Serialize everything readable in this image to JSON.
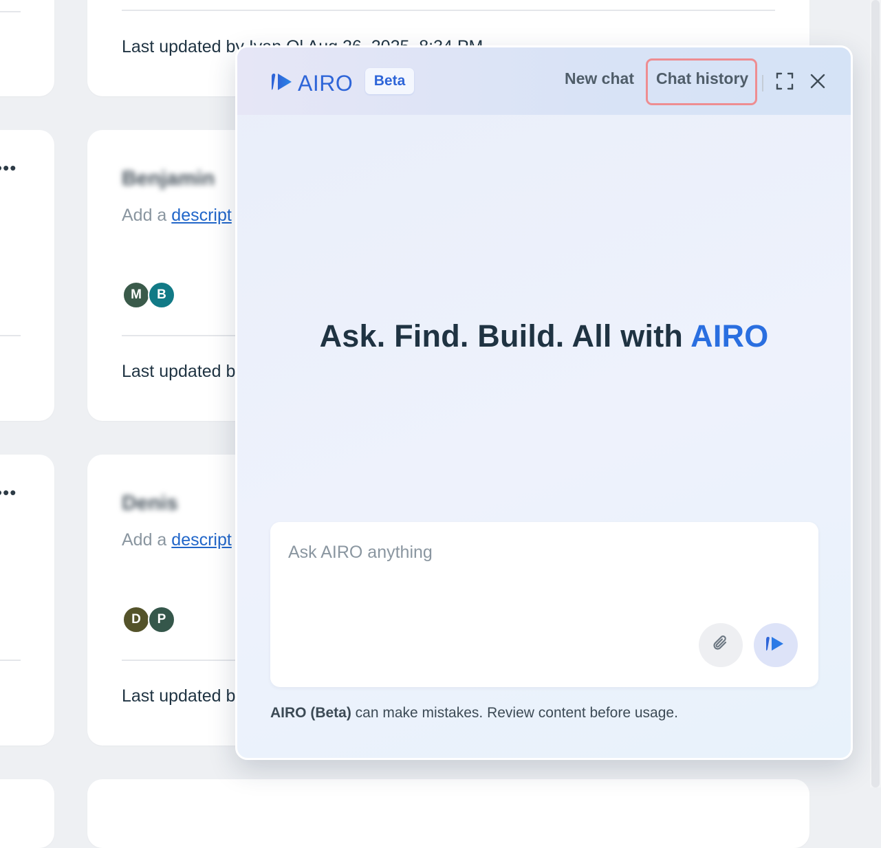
{
  "background": {
    "cards": [
      {
        "title": "",
        "description_prefix": "",
        "description_link": "",
        "avatars": [],
        "updated_text": "Last updated by Ivan Ol Aug 26, 2025, 8:34 PM"
      },
      {
        "title": "Benjamin",
        "description_prefix": "Add a",
        "description_link": "descript",
        "avatars": [
          {
            "initial": "M",
            "color": "#3a5a4a"
          },
          {
            "initial": "B",
            "color": "#127a86"
          }
        ],
        "updated_text": "Last updated b"
      },
      {
        "title": "Denis",
        "description_prefix": "Add a",
        "description_link": "descript",
        "avatars": [
          {
            "initial": "D",
            "color": "#54532a"
          },
          {
            "initial": "P",
            "color": "#35574b"
          }
        ],
        "updated_text": "Last updated b"
      }
    ],
    "more_icon": "more-horizontal-icon"
  },
  "airo": {
    "logo_text": "AIRO",
    "logo_icon": "airo-logo-icon",
    "beta_badge": "Beta",
    "header": {
      "new_chat": "New chat",
      "chat_history": "Chat history",
      "expand_icon": "expand-icon",
      "close_icon": "close-icon",
      "highlight_color": "#ee8d91"
    },
    "headline": {
      "text": "Ask. Find. Build. All with ",
      "accent": "AIRO",
      "accent_color": "#2a6fe0"
    },
    "input": {
      "placeholder": "Ask AIRO anything",
      "value": "",
      "attach_icon": "paperclip-icon",
      "send_icon": "send-icon"
    },
    "disclaimer": {
      "bold": "AIRO (Beta)",
      "rest": " can make mistakes. Review content before usage."
    },
    "colors": {
      "brand": "#2e65d8",
      "text": "#1f3342"
    }
  }
}
